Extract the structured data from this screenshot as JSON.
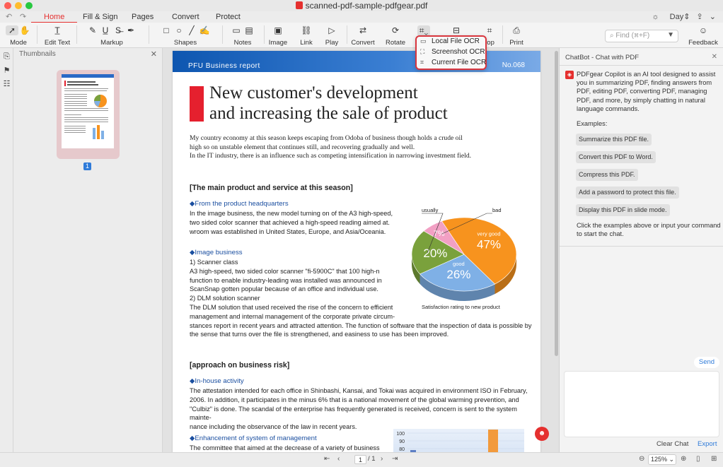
{
  "window": {
    "title": "scanned-pdf-sample-pdfgear.pdf"
  },
  "tabs": [
    {
      "label": "Home",
      "active": true
    },
    {
      "label": "Fill & Sign"
    },
    {
      "label": "Pages"
    },
    {
      "label": "Convert"
    },
    {
      "label": "Protect"
    }
  ],
  "theme": {
    "label": "Day",
    "accent": "#e5302f",
    "link": "#2f7bd9"
  },
  "ribbon": {
    "mode": "Mode",
    "edit_text": "Edit Text",
    "markup": "Markup",
    "shapes": "Shapes",
    "notes": "Notes",
    "image": "Image",
    "link": "Link",
    "play": "Play",
    "convert": "Convert",
    "rotate": "Rotate",
    "crop": "rop",
    "print": "Print",
    "feedback": "Feedback",
    "find_placeholder": "Find (⌘+F)"
  },
  "ocr_menu": [
    {
      "label": "Local File OCR",
      "icon": "folder-icon"
    },
    {
      "label": "Screenshot OCR",
      "icon": "screenshot-icon"
    },
    {
      "label": "Current File OCR",
      "icon": "scan-icon"
    }
  ],
  "thumbnails": {
    "title": "Thumbnails",
    "page_badge": "1"
  },
  "document": {
    "banner_left": "PFU Business report",
    "banner_right": "No.068",
    "headline_1": "New customer's development",
    "headline_2": "and increasing the sale of product",
    "intro_1": "My country economy at this season keeps escaping from Odoba of business though holds a crude oil",
    "intro_2": "high so on unstable element that continues still, and recovering gradually and well.",
    "intro_3": "In the IT industry, there is an influence such as competing intensification in narrowing investment field.",
    "section1": "[The main product and service at this season]",
    "sub1": "◆From the product headquarters",
    "p1_1": "In the image business, the new model turning on of the A3 high-speed,",
    "p1_2": "two sided color scanner that achieved a high-speed reading aimed at.",
    "p1_3": "wroom was established in United States, Europe, and Asia/Oceania.",
    "sub2": "◆Image business",
    "p2_1": "1) Scanner class",
    "p2_2": "A3 high-speed, two sided color scanner \"fi-5900C\" that 100 high-n",
    "p2_3": "function to enable industry-leading was installed was announced in",
    "p2_4": "ScanSnap gotten popular because of an office and individual use.",
    "p2_5": "2) DLM solution scanner",
    "p2_6": "The DLM solution that used received the rise of the concern to efficient",
    "p2_7": "management and internal management of the corporate private circum-",
    "p2_8": "stances report in recent years and attracted attention. The function of software that the inspection of data is possible by",
    "p2_9": "the sense that turns over the file is strengthened, and easiness to use has been improved.",
    "section2": "[approach on business risk]",
    "sub3": "◆In-house activity",
    "p3_1": "The attestation intended for each office in Shinbashi, Kansai, and Tokai was acquired in environment ISO in February,",
    "p3_2": "2006. In addition, it participates in the minus 6% that is a national movement of the global warming prevention, and",
    "p3_3": "\"Culbiz\" is done. The scandal of the enterprise has frequently generated is received, concern is sent to the system mainte-",
    "p3_4": "nance including the observance of the law in recent years.",
    "sub4": "◆Enhancement of system of management",
    "p4_1": "The committee that aimed at the decrease of a variety of business"
  },
  "chart_data": [
    {
      "type": "pie",
      "title": "Satisfaction rating to new product",
      "categories": [
        "very good",
        "good",
        "usually",
        "bad"
      ],
      "values": [
        47,
        26,
        20,
        7
      ],
      "value_labels": [
        "47%",
        "26%",
        "20%",
        "7%"
      ],
      "colors": [
        "#f7931e",
        "#7fb0e6",
        "#7aa13c",
        "#f2a0c4"
      ]
    },
    {
      "type": "bar",
      "yticks": [
        "100",
        "90",
        "80"
      ],
      "ylim": [
        80,
        100
      ]
    }
  ],
  "chat": {
    "header": "ChatBot - Chat with PDF",
    "intro": "PDFgear Copilot is an AI tool designed to assist you in summarizing PDF, finding answers from PDF, editing PDF, converting PDF, managing PDF, and more, by simply chatting in natural language commands.",
    "examples_label": "Examples:",
    "examples": [
      "Summarize this PDF file.",
      "Convert this PDF to Word.",
      "Compress this PDF.",
      "Add a password to protect this file.",
      "Display this PDF in slide mode."
    ],
    "outro": "Click the examples above or input your command to start the chat.",
    "send": "Send",
    "clear": "Clear Chat",
    "export": "Export"
  },
  "footer": {
    "page_current": "1",
    "page_total": "/ 1",
    "zoom": "125%"
  }
}
